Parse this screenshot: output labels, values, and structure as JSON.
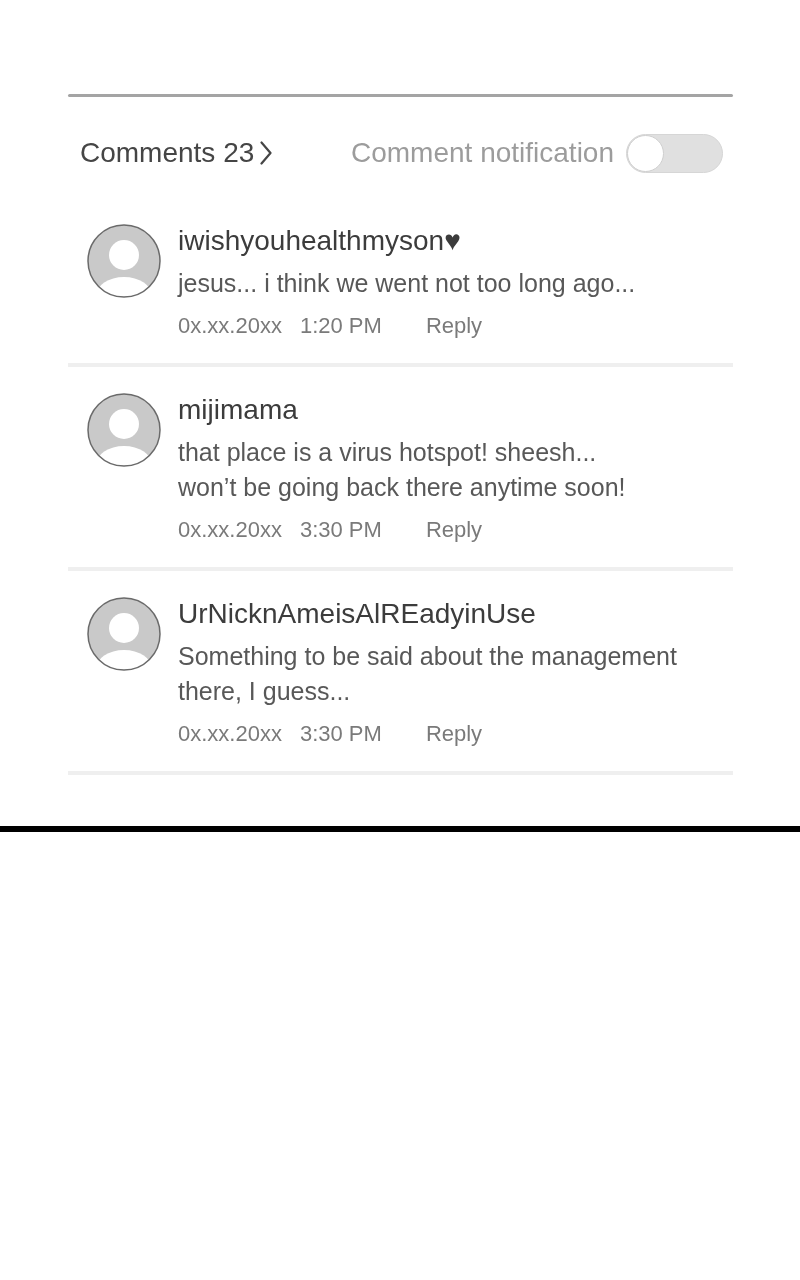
{
  "header": {
    "title": "Comments",
    "count": "23"
  },
  "notification": {
    "label": "Comment notification",
    "on": false
  },
  "comments": [
    {
      "username": "iwishyouhealthmyson♥",
      "text": "jesus... i think we went not too long ago...",
      "date": "0x.xx.20xx",
      "time": "1:20 PM",
      "reply": "Reply"
    },
    {
      "username": "mijimama",
      "text": "that place is a virus hotspot! sheesh...\nwon’t be going back there anytime soon!",
      "date": "0x.xx.20xx",
      "time": "3:30 PM",
      "reply": "Reply"
    },
    {
      "username": "UrNicknAmeisAlREadyinUse",
      "text": "Something to be said about the management there, I guess...",
      "date": "0x.xx.20xx",
      "time": "3:30 PM",
      "reply": "Reply"
    }
  ]
}
